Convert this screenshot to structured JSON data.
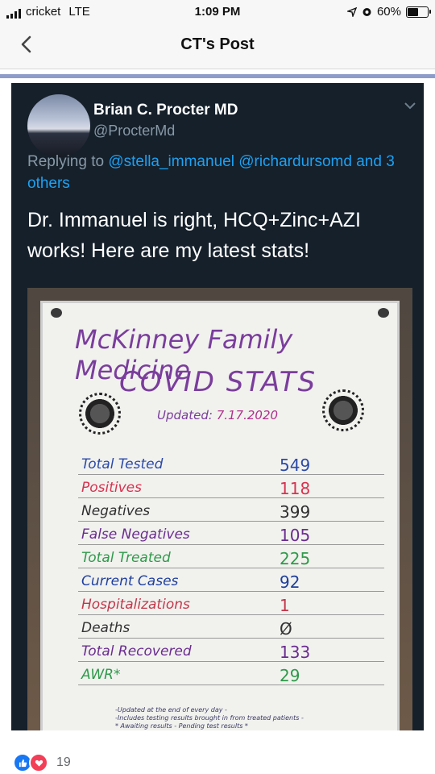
{
  "status_bar": {
    "carrier": "cricket",
    "network": "LTE",
    "time": "1:09 PM",
    "battery": "60%",
    "battery_level": 0.6
  },
  "nav": {
    "title": "CT's Post",
    "back_icon": "chevron-left-icon"
  },
  "tweet": {
    "author": "Brian C. Procter MD",
    "handle": "@ProcterMd",
    "replying_prefix": "Replying to",
    "mention_1": "@stella_immanuel",
    "mention_2": "@richardursomd",
    "replying_suffix": "and",
    "others": "3 others",
    "text": "Dr. Immanuel is right, HCQ+Zinc+AZI works!  Here are my latest stats!"
  },
  "whiteboard": {
    "title": "McKinney Family Medicine",
    "subtitle": "COVID STATS",
    "updated_label": "Updated:",
    "updated_date": "7.17.2020",
    "rows": [
      {
        "label": "Total Tested",
        "value": "549",
        "label_color": "#2b4aa8",
        "value_color": "#2b4aa8"
      },
      {
        "label": "Positives",
        "value": "118",
        "label_color": "#d8324f",
        "value_color": "#d8324f"
      },
      {
        "label": "Negatives",
        "value": "399",
        "label_color": "#2f2f2f",
        "value_color": "#2f2f2f"
      },
      {
        "label": "False Negatives",
        "value": "105",
        "label_color": "#6a2c8f",
        "value_color": "#6a2c8f"
      },
      {
        "label": "Total Treated",
        "value": "225",
        "label_color": "#2e9a4a",
        "value_color": "#2e9a4a"
      },
      {
        "label": "Current Cases",
        "value": "92",
        "label_color": "#1e3f9e",
        "value_color": "#1e3f9e"
      },
      {
        "label": "Hospitalizations",
        "value": "1",
        "label_color": "#c2374a",
        "value_color": "#c2374a"
      },
      {
        "label": "Deaths",
        "value": "Ø",
        "label_color": "#333333",
        "value_color": "#333333"
      },
      {
        "label": "Total Recovered",
        "value": "133",
        "label_color": "#6a2c8f",
        "value_color": "#6a2c8f"
      },
      {
        "label": "AWR*",
        "value": "29",
        "label_color": "#2e9a4a",
        "value_color": "#2e9a4a"
      }
    ],
    "notes": [
      "-Updated at the end of every day -",
      "-Includes testing results brought in from treated patients -",
      "* Awaiting results - Pending test results *"
    ]
  },
  "reactions": {
    "count": "19",
    "icons": [
      "like-icon",
      "love-icon"
    ]
  }
}
